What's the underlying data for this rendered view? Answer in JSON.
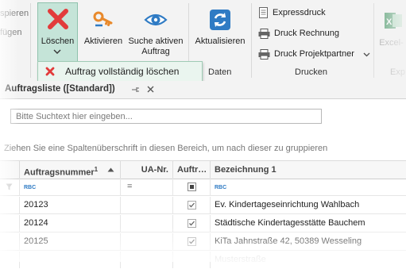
{
  "ribbon": {
    "partial_left_1": "spieren",
    "partial_left_2": "fügen",
    "delete_label": "Löschen",
    "activate_label": "Aktivieren",
    "search_active_line1": "Suche aktiven",
    "search_active_line2": "Auftrag",
    "refresh_label": "Aktualisieren",
    "group_daten": "Daten",
    "express_print": "Expressdruck",
    "print_invoice": "Druck Rechnung",
    "print_project_partner": "Druck Projektpartner",
    "group_druck": "Drucken",
    "excel_label": "Excel-",
    "group_export_partial": "Exp"
  },
  "dropdown": {
    "delete_order_fully": "Auftrag vollständig löschen"
  },
  "tab": {
    "title": "Auftragsliste ([Standard])"
  },
  "search": {
    "placeholder": "Bitte Suchtext hier eingeben..."
  },
  "group_hint": "Ziehen Sie eine Spaltenüberschrift in diesen Bereich, um nach dieser zu gruppieren",
  "grid": {
    "columns": {
      "order_number": "Auftragsnummer",
      "order_number_sort_index": "1",
      "ua_nr": "UA-Nr.",
      "auftr": "Auftr…",
      "description": "Bezeichnung 1"
    },
    "filter_row": {
      "rbc": "RBC",
      "equals": "="
    },
    "rows": [
      {
        "number": "20123",
        "checked": true,
        "description": "Ev. Kindertageseinrichtung Wahlbach"
      },
      {
        "number": "20124",
        "checked": true,
        "description": "Städtische Kindertagesstätte Bauchem"
      },
      {
        "number": "20125",
        "checked": true,
        "description": "KiTa Jahnstraße 42, 50389 Wesseling"
      },
      {
        "number": "",
        "checked": false,
        "description": "Musterstraße"
      }
    ]
  },
  "colors": {
    "delete_red": "#e23b3b",
    "key_orange": "#e8892b",
    "refresh_blue": "#2f7bc4",
    "excel_green": "#2f8a53",
    "selected_green": "#c5e4d8"
  }
}
